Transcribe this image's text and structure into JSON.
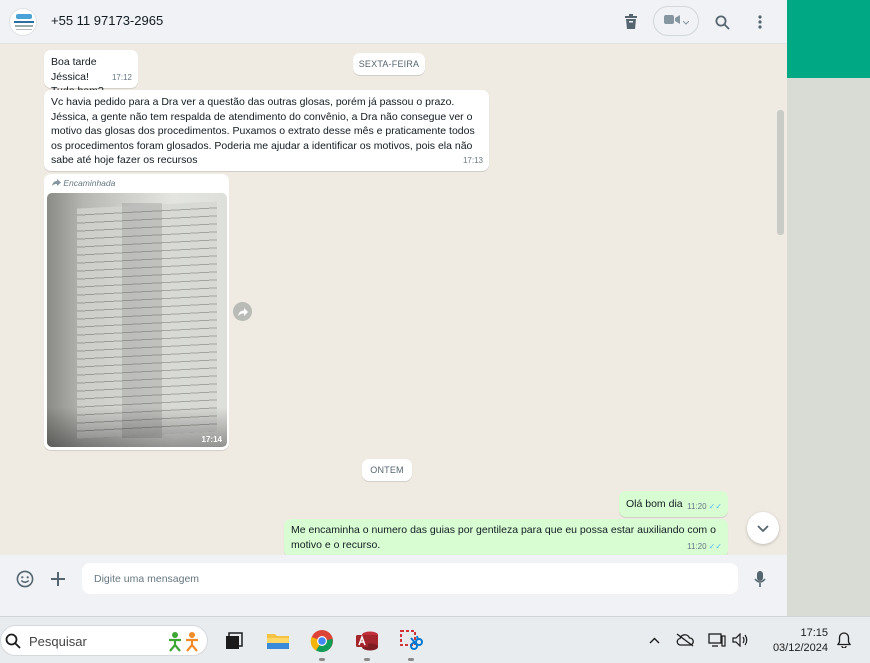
{
  "header": {
    "contact_name": "+55 11 97173-2965",
    "icons": [
      "archive-icon",
      "video-call-icon",
      "search-icon",
      "menu-dots-icon"
    ]
  },
  "chat": {
    "date_separators": [
      "SEXTA-FEIRA",
      "ONTEM"
    ],
    "messages": [
      {
        "direction": "in",
        "lines": [
          "Boa tarde Jéssica!",
          "Tudo bem?"
        ],
        "time": "17:12"
      },
      {
        "direction": "in",
        "lines": [
          "Vc havia pedido para a Dra ver a questão das outras glosas, porém já passou o prazo.",
          "Jéssica, a gente não tem respalda de atendimento do convênio, a Dra não consegue ver o",
          "motivo das glosas dos procedimentos. Puxamos o extrato desse mês e praticamente todos",
          "os procedimentos foram glosados. Poderia me ajudar a identificar os motivos, pois ela não",
          "sabe até hoje fazer os recursos"
        ],
        "time": "17:13"
      },
      {
        "direction": "in",
        "type": "image",
        "forwarded_label": "Encaminhada",
        "time": "17:14"
      },
      {
        "direction": "out",
        "lines": [
          "Olá bom dia"
        ],
        "time": "11:20"
      },
      {
        "direction": "out",
        "lines": [
          "Me encaminha o numero das guias por gentileza para que eu possa estar auxiliando com o",
          "motivo e o recurso."
        ],
        "time": "11:20"
      }
    ]
  },
  "composer": {
    "placeholder": "Digite uma mensagem",
    "icons": [
      "emoji-icon",
      "attach-plus-icon",
      "microphone-icon"
    ]
  },
  "taskbar": {
    "search_placeholder": "Pesquisar",
    "apps": [
      "task-view-icon",
      "file-explorer-icon",
      "chrome-icon",
      "access-icon",
      "snipping-tool-icon"
    ],
    "clock_time": "17:15",
    "clock_date": "03/12/2024"
  },
  "colors": {
    "chat_background": "#efeae2",
    "incoming_bubble": "#ffffff",
    "outgoing_bubble": "#d9fdd3",
    "accent": "#00a884",
    "read_ticks": "#53bdeb"
  }
}
